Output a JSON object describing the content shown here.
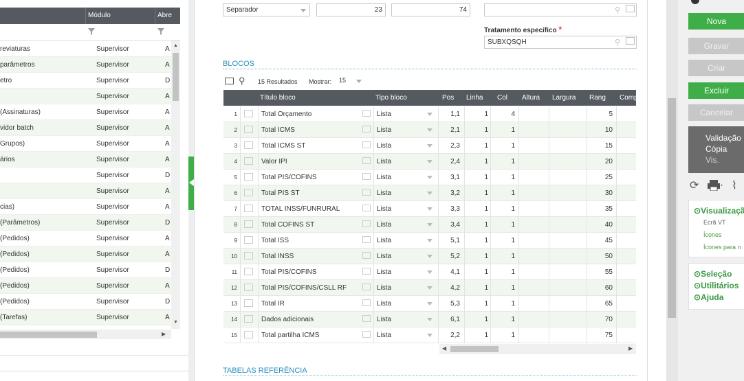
{
  "left_list": {
    "col_modulo": "Módulo",
    "col_abrev": "Abre",
    "rows": [
      {
        "name": "reviaturas",
        "module": "Supervisor",
        "flag": "A"
      },
      {
        "name": "parâmetros",
        "module": "Supervisor",
        "flag": "A"
      },
      {
        "name": "etro",
        "module": "Supervisor",
        "flag": "D"
      },
      {
        "name": "",
        "module": "Supervisor",
        "flag": "A"
      },
      {
        "name": "(Assinaturas)",
        "module": "Supervisor",
        "flag": "A"
      },
      {
        "name": "vidor batch",
        "module": "Supervisor",
        "flag": "A"
      },
      {
        "name": "Grupos)",
        "module": "Supervisor",
        "flag": "A"
      },
      {
        "name": "ários",
        "module": "Supervisor",
        "flag": "A"
      },
      {
        "name": "",
        "module": "Supervisor",
        "flag": "D"
      },
      {
        "name": "",
        "module": "Supervisor",
        "flag": "A"
      },
      {
        "name": "cias)",
        "module": "Supervisor",
        "flag": "A"
      },
      {
        "name": "(Parâmetros)",
        "module": "Supervisor",
        "flag": "D"
      },
      {
        "name": "(Pedidos)",
        "module": "Supervisor",
        "flag": "A"
      },
      {
        "name": "(Pedidos)",
        "module": "Supervisor",
        "flag": "A"
      },
      {
        "name": "(Pedidos)",
        "module": "Supervisor",
        "flag": "D"
      },
      {
        "name": "(Pedidos)",
        "module": "Supervisor",
        "flag": "A"
      },
      {
        "name": "(Pedidos)",
        "module": "Supervisor",
        "flag": "D"
      },
      {
        "name": "(Tarefas)",
        "module": "Supervisor",
        "flag": "A"
      }
    ]
  },
  "form": {
    "separator_value": "Separador",
    "num1": "23",
    "num2": "74",
    "tratamento_label": "Tratamento específico",
    "required_mark": "*",
    "tratamento_value": "SUBXQSQH",
    "blocos_title": "BLOCOS",
    "results_text": "15 Resultados",
    "mostrar_label": "Mostrar:",
    "mostrar_value": "15",
    "tabelas_title": "TABELAS REFERÊNCIA"
  },
  "grid": {
    "headers": {
      "titulo": "Título bloco",
      "tipo": "Tipo bloco",
      "pos": "Pos",
      "linha": "Linha",
      "col": "Col",
      "altura": "Altura",
      "largura": "Largura",
      "rang": "Rang",
      "comp": "Comp"
    },
    "rows": [
      {
        "n": "1",
        "title": "Total Orçamento",
        "type": "Lista",
        "pos": "1,1",
        "linha": "1",
        "col": "4",
        "rang": "5"
      },
      {
        "n": "2",
        "title": "Total ICMS",
        "type": "Lista",
        "pos": "2,1",
        "linha": "1",
        "col": "1",
        "rang": "10"
      },
      {
        "n": "3",
        "title": "Total ICMS ST",
        "type": "Lista",
        "pos": "2,3",
        "linha": "1",
        "col": "1",
        "rang": "15"
      },
      {
        "n": "4",
        "title": "Valor IPI",
        "type": "Lista",
        "pos": "2,4",
        "linha": "1",
        "col": "1",
        "rang": "20"
      },
      {
        "n": "5",
        "title": "Total PIS/COFINS",
        "type": "Lista",
        "pos": "3,1",
        "linha": "1",
        "col": "1",
        "rang": "25"
      },
      {
        "n": "6",
        "title": "Total PIS ST",
        "type": "Lista",
        "pos": "3,2",
        "linha": "1",
        "col": "1",
        "rang": "30"
      },
      {
        "n": "7",
        "title": "TOTAL INSS/FUNRURAL",
        "type": "Lista",
        "pos": "3,3",
        "linha": "1",
        "col": "1",
        "rang": "35"
      },
      {
        "n": "8",
        "title": "Total COFINS ST",
        "type": "Lista",
        "pos": "3,4",
        "linha": "1",
        "col": "1",
        "rang": "40"
      },
      {
        "n": "9",
        "title": "Total ISS",
        "type": "Lista",
        "pos": "5,1",
        "linha": "1",
        "col": "1",
        "rang": "45"
      },
      {
        "n": "10",
        "title": "Total INSS",
        "type": "Lista",
        "pos": "5,2",
        "linha": "1",
        "col": "1",
        "rang": "50"
      },
      {
        "n": "11",
        "title": "Total PIS/COFINS",
        "type": "Lista",
        "pos": "4,1",
        "linha": "1",
        "col": "1",
        "rang": "55"
      },
      {
        "n": "12",
        "title": "Total PIS/COFINS/CSLL RF",
        "type": "Lista",
        "pos": "4,2",
        "linha": "1",
        "col": "1",
        "rang": "60"
      },
      {
        "n": "13",
        "title": "Total IR",
        "type": "Lista",
        "pos": "5,3",
        "linha": "1",
        "col": "1",
        "rang": "65"
      },
      {
        "n": "14",
        "title": "Dados adicionais",
        "type": "Lista",
        "pos": "6,1",
        "linha": "1",
        "col": "1",
        "rang": "70"
      },
      {
        "n": "15",
        "title": "Total partilha ICMS",
        "type": "Lista",
        "pos": "2,2",
        "linha": "1",
        "col": "1",
        "rang": "75"
      }
    ]
  },
  "actions": {
    "nova": "Nova",
    "gravar": "Gravar",
    "criar": "Criar",
    "excluir": "Excluir",
    "cancelar": "Cancelar",
    "validacao": "Validação",
    "copia": "Cópia",
    "vis": "Vis."
  },
  "side_links": {
    "visualizacao": "Visualizaçã",
    "ecra_vt": "Ecrã VT",
    "icones": "Ícones",
    "icones_para": "Ícones para n",
    "selecao": "Seleção",
    "utilitarios": "Utilitários",
    "ajuda": "Ajuda"
  },
  "colors": {
    "accent_green": "#3fae49",
    "header_dark": "#555a61",
    "link_blue": "#2a8fbd"
  }
}
